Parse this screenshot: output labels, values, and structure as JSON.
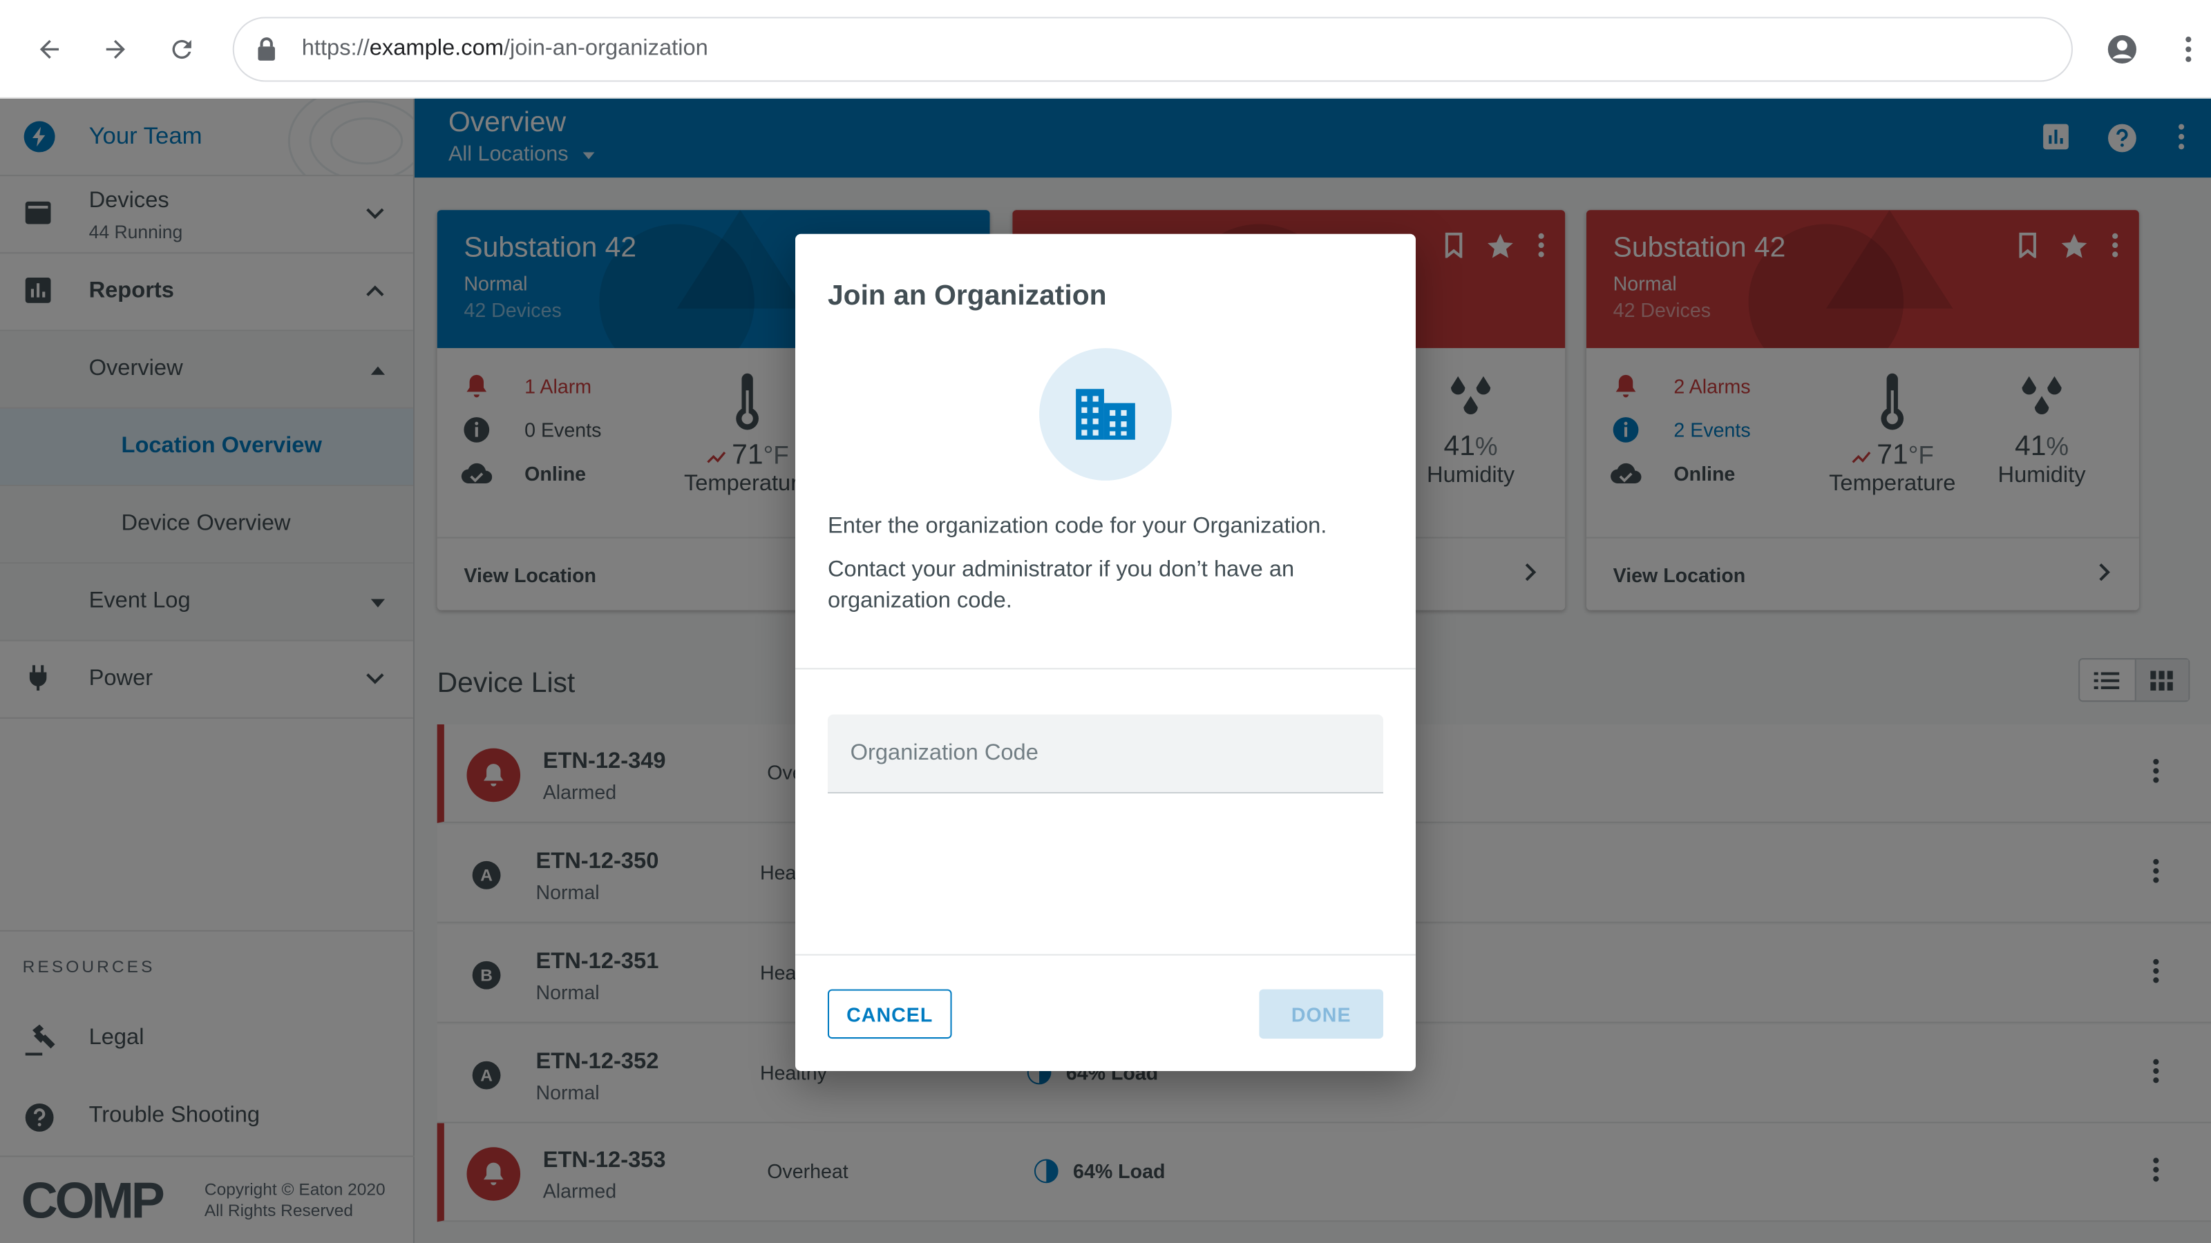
{
  "browser": {
    "url_prefix": "https://",
    "url_host": "example.com",
    "url_path": "/join-an-organization"
  },
  "colors": {
    "primary": "#007bc1",
    "alarm": "#ca3c3d",
    "text": "#424e54"
  },
  "sidebar": {
    "brand": "Your Team",
    "items": [
      {
        "label": "Devices",
        "sub": "44 Running",
        "icon": "devices-icon"
      },
      {
        "label": "Reports",
        "icon": "bar-chart-icon"
      },
      {
        "label": "Overview"
      },
      {
        "label": "Location Overview"
      },
      {
        "label": "Device Overview"
      },
      {
        "label": "Event Log"
      },
      {
        "label": "Power",
        "icon": "plug-icon"
      }
    ],
    "resources_title": "RESOURCES",
    "resources": [
      {
        "label": "Legal",
        "icon": "gavel-icon"
      },
      {
        "label": "Trouble Shooting",
        "icon": "help-icon"
      }
    ],
    "footer_logo": "COMP",
    "copyright_1": "Copyright © Eaton 2020",
    "copyright_2": "All Rights Reserved"
  },
  "topbar": {
    "title": "Overview",
    "subtitle": "All Locations"
  },
  "cards": [
    {
      "title": "Substation 42",
      "status": "Normal",
      "devices": "42 Devices",
      "alarms": "1 Alarm",
      "events": "0 Events",
      "online": "Online",
      "temp_value": "71",
      "temp_unit": "°F",
      "temp_label": "Temperature",
      "view": "View Location"
    },
    {
      "humidity_value": "41",
      "humidity_unit": "%",
      "humidity_label": "Humidity"
    },
    {
      "title": "Substation 42",
      "status": "Normal",
      "devices": "42 Devices",
      "alarms": "2 Alarms",
      "events": "2 Events",
      "online": "Online",
      "temp_value": "71",
      "temp_unit": "°F",
      "temp_label": "Temperature",
      "humidity_value": "41",
      "humidity_unit": "%",
      "humidity_label": "Humidity",
      "view": "View Location"
    }
  ],
  "device_list": {
    "title": "Device List",
    "rows": [
      {
        "name": "ETN-12-349",
        "status": "Alarmed",
        "cond": "Ove",
        "load": ""
      },
      {
        "name": "ETN-12-350",
        "status": "Normal",
        "cond": "Hea",
        "badge": "A",
        "load": ""
      },
      {
        "name": "ETN-12-351",
        "status": "Normal",
        "cond": "Hea",
        "badge": "B",
        "load": ""
      },
      {
        "name": "ETN-12-352",
        "status": "Normal",
        "cond": "Healthy",
        "badge": "A",
        "load": "64% Load"
      },
      {
        "name": "ETN-12-353",
        "status": "Alarmed",
        "cond": "Overheat",
        "load": "64% Load"
      }
    ]
  },
  "dialog": {
    "title": "Join an Organization",
    "text1": "Enter the organization code for your Organization.",
    "text2": "Contact your administrator if you don’t have an organization code.",
    "input_placeholder": "Organization Code",
    "cancel": "CANCEL",
    "done": "DONE"
  }
}
